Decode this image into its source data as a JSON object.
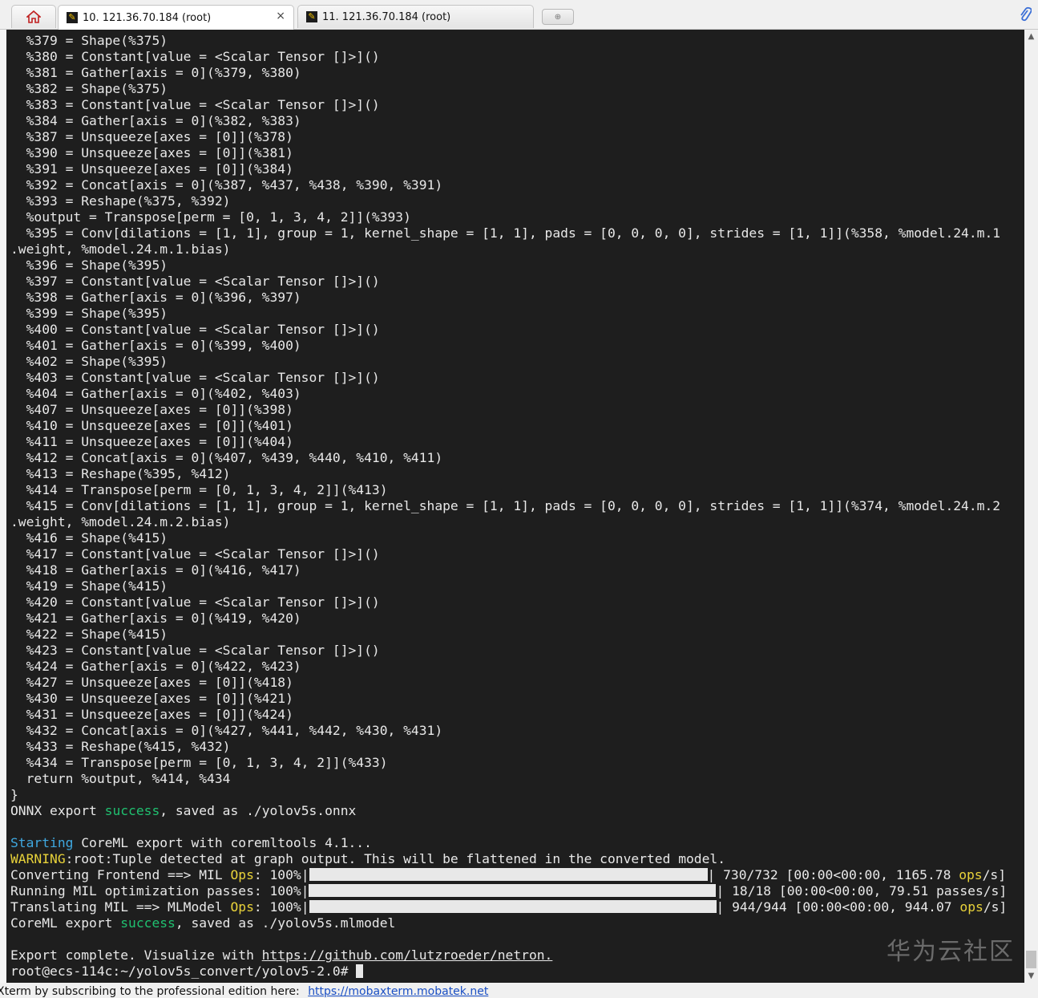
{
  "tabs": {
    "home_icon": "home-icon",
    "items": [
      {
        "label": "10. 121.36.70.184 (root)",
        "active": true,
        "close": "×"
      },
      {
        "label": "11. 121.36.70.184 (root)",
        "active": false
      }
    ],
    "new_tab_glyph": "⊕",
    "attach_icon": "paperclip-icon"
  },
  "terminal": {
    "lines": [
      [
        {
          "t": "  %379 = Shape(%375)"
        }
      ],
      [
        {
          "t": "  %380 = Constant[value = <Scalar Tensor []>]()"
        }
      ],
      [
        {
          "t": "  %381 = Gather[axis = 0](%379, %380)"
        }
      ],
      [
        {
          "t": "  %382 = Shape(%375)"
        }
      ],
      [
        {
          "t": "  %383 = Constant[value = <Scalar Tensor []>]()"
        }
      ],
      [
        {
          "t": "  %384 = Gather[axis = 0](%382, %383)"
        }
      ],
      [
        {
          "t": "  %387 = Unsqueeze[axes = [0]](%378)"
        }
      ],
      [
        {
          "t": "  %390 = Unsqueeze[axes = [0]](%381)"
        }
      ],
      [
        {
          "t": "  %391 = Unsqueeze[axes = [0]](%384)"
        }
      ],
      [
        {
          "t": "  %392 = Concat[axis = 0](%387, %437, %438, %390, %391)"
        }
      ],
      [
        {
          "t": "  %393 = Reshape(%375, %392)"
        }
      ],
      [
        {
          "t": "  %output = Transpose[perm = [0, 1, 3, 4, 2]](%393)"
        }
      ],
      [
        {
          "t": "  %395 = Conv[dilations = [1, 1], group = 1, kernel_shape = [1, 1], pads = [0, 0, 0, 0], strides = [1, 1]](%358, %model.24.m.1"
        }
      ],
      [
        {
          "t": ".weight, %model.24.m.1.bias)"
        }
      ],
      [
        {
          "t": "  %396 = Shape(%395)"
        }
      ],
      [
        {
          "t": "  %397 = Constant[value = <Scalar Tensor []>]()"
        }
      ],
      [
        {
          "t": "  %398 = Gather[axis = 0](%396, %397)"
        }
      ],
      [
        {
          "t": "  %399 = Shape(%395)"
        }
      ],
      [
        {
          "t": "  %400 = Constant[value = <Scalar Tensor []>]()"
        }
      ],
      [
        {
          "t": "  %401 = Gather[axis = 0](%399, %400)"
        }
      ],
      [
        {
          "t": "  %402 = Shape(%395)"
        }
      ],
      [
        {
          "t": "  %403 = Constant[value = <Scalar Tensor []>]()"
        }
      ],
      [
        {
          "t": "  %404 = Gather[axis = 0](%402, %403)"
        }
      ],
      [
        {
          "t": "  %407 = Unsqueeze[axes = [0]](%398)"
        }
      ],
      [
        {
          "t": "  %410 = Unsqueeze[axes = [0]](%401)"
        }
      ],
      [
        {
          "t": "  %411 = Unsqueeze[axes = [0]](%404)"
        }
      ],
      [
        {
          "t": "  %412 = Concat[axis = 0](%407, %439, %440, %410, %411)"
        }
      ],
      [
        {
          "t": "  %413 = Reshape(%395, %412)"
        }
      ],
      [
        {
          "t": "  %414 = Transpose[perm = [0, 1, 3, 4, 2]](%413)"
        }
      ],
      [
        {
          "t": "  %415 = Conv[dilations = [1, 1], group = 1, kernel_shape = [1, 1], pads = [0, 0, 0, 0], strides = [1, 1]](%374, %model.24.m.2"
        }
      ],
      [
        {
          "t": ".weight, %model.24.m.2.bias)"
        }
      ],
      [
        {
          "t": "  %416 = Shape(%415)"
        }
      ],
      [
        {
          "t": "  %417 = Constant[value = <Scalar Tensor []>]()"
        }
      ],
      [
        {
          "t": "  %418 = Gather[axis = 0](%416, %417)"
        }
      ],
      [
        {
          "t": "  %419 = Shape(%415)"
        }
      ],
      [
        {
          "t": "  %420 = Constant[value = <Scalar Tensor []>]()"
        }
      ],
      [
        {
          "t": "  %421 = Gather[axis = 0](%419, %420)"
        }
      ],
      [
        {
          "t": "  %422 = Shape(%415)"
        }
      ],
      [
        {
          "t": "  %423 = Constant[value = <Scalar Tensor []>]()"
        }
      ],
      [
        {
          "t": "  %424 = Gather[axis = 0](%422, %423)"
        }
      ],
      [
        {
          "t": "  %427 = Unsqueeze[axes = [0]](%418)"
        }
      ],
      [
        {
          "t": "  %430 = Unsqueeze[axes = [0]](%421)"
        }
      ],
      [
        {
          "t": "  %431 = Unsqueeze[axes = [0]](%424)"
        }
      ],
      [
        {
          "t": "  %432 = Concat[axis = 0](%427, %441, %442, %430, %431)"
        }
      ],
      [
        {
          "t": "  %433 = Reshape(%415, %432)"
        }
      ],
      [
        {
          "t": "  %434 = Transpose[perm = [0, 1, 3, 4, 2]](%433)"
        }
      ],
      [
        {
          "t": "  return %output, %414, %434"
        }
      ],
      [
        {
          "t": "}"
        }
      ],
      [
        {
          "t": "ONNX export "
        },
        {
          "t": "success",
          "c": "green"
        },
        {
          "t": ", saved as ./yolov5s.onnx"
        }
      ],
      [
        {
          "t": ""
        }
      ],
      [
        {
          "t": "Starting",
          "c": "cyan"
        },
        {
          "t": " CoreML export with coremltools 4.1..."
        }
      ],
      [
        {
          "t": "WARNING",
          "c": "yellow"
        },
        {
          "t": ":root:Tuple detected at graph output. This will be flattened in the converted model."
        }
      ],
      [
        {
          "t": "Converting Frontend ==> MIL "
        },
        {
          "t": "Ops",
          "c": "yellow"
        },
        {
          "t": ": 100%|"
        },
        {
          "bar": 497
        },
        {
          "t": "| 730/732 [00:00<00:00, 1165.78 "
        },
        {
          "t": "ops",
          "c": "yellow"
        },
        {
          "t": "/s]"
        }
      ],
      [
        {
          "t": "Running MIL optimization passes: 100%|"
        },
        {
          "bar": 508
        },
        {
          "t": "| 18/18 [00:00<00:00, 79.51 passes/s]"
        }
      ],
      [
        {
          "t": "Translating MIL ==> MLModel "
        },
        {
          "t": "Ops",
          "c": "yellow"
        },
        {
          "t": ": 100%|"
        },
        {
          "bar": 508
        },
        {
          "t": "| 944/944 [00:00<00:00, 944.07 "
        },
        {
          "t": "ops",
          "c": "yellow"
        },
        {
          "t": "/s]"
        }
      ],
      [
        {
          "t": "CoreML export "
        },
        {
          "t": "success",
          "c": "green"
        },
        {
          "t": ", saved as ./yolov5s.mlmodel"
        }
      ],
      [
        {
          "t": ""
        }
      ],
      [
        {
          "t": "Export complete. Visualize with "
        },
        {
          "t": "https://github.com/lutzroeder/netron.",
          "c": "link"
        }
      ],
      [
        {
          "t": "root@ecs-114c:~/yolov5s_convert/yolov5-2.0# "
        },
        {
          "cursor": true
        }
      ]
    ],
    "watermark": "华为云社区"
  },
  "scrollbar": {
    "up": "▲",
    "down": "▼"
  },
  "statusbar": {
    "message": "Xterm by subscribing to the professional edition here:",
    "link": "https://mobaxterm.mobatek.net"
  }
}
